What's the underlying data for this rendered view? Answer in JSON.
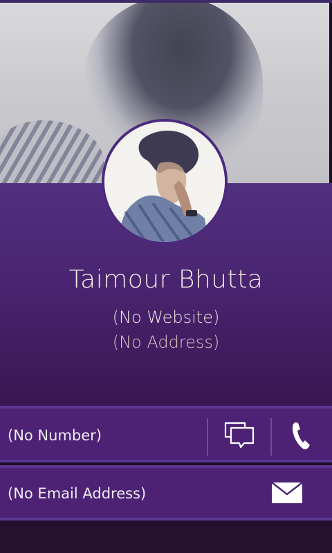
{
  "profile": {
    "name": "Taimour Bhutta",
    "website": "(No Website)",
    "address": "(No Address)"
  },
  "contact": {
    "phone_label": "(No Number)",
    "email_label": "(No Email Address)"
  },
  "icons": {
    "message": "message-icon",
    "call": "phone-icon",
    "email": "envelope-icon"
  },
  "colors": {
    "accent": "#5b3693",
    "card": "#4a2470",
    "text": "#f3ece6"
  }
}
